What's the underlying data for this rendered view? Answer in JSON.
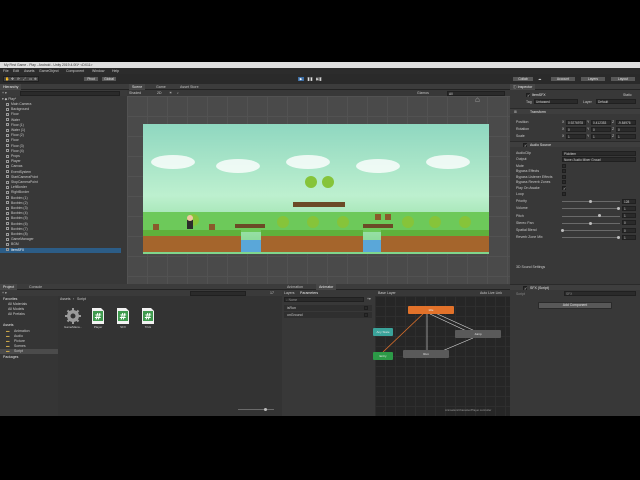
{
  "window": {
    "title": "My First Game - Play - Android - Unity 2019.4.0f1* <DX11>",
    "menu": [
      "File",
      "Edit",
      "Assets",
      "GameObject",
      "Component",
      "Window",
      "Help"
    ]
  },
  "toolbar": {
    "pivot_label": "Pivot",
    "global_label": "Global",
    "collab_label": "Collab",
    "account_label": "Account",
    "layers_label": "Layers",
    "layout_label": "Layout"
  },
  "hierarchy": {
    "tab_label": "Hierarchy",
    "scene_name": "Play*",
    "items": [
      "Main Camera",
      "Background",
      "Floor",
      "Water",
      "Floor (1)",
      "Water (1)",
      "Floor (2)",
      "Floor",
      "Floor (3)",
      "Floor (4)",
      "Props",
      "Player",
      "Canvas",
      "EventSystem",
      "StartCameraPoint",
      "StopCameraPoint",
      "LeftBorder",
      "RightBorder",
      "Boxbtm (1)",
      "Boxbtm (2)",
      "Boxbtm (3)",
      "Boxbtm (4)",
      "Boxbtm (5)",
      "Boxbtm (6)",
      "Boxbtm (7)",
      "Boxbtm (8)",
      "GameManager",
      "BGM",
      "ItemSFX"
    ],
    "selected_item": "ItemSFX"
  },
  "scene_view": {
    "tabs": [
      "Scene",
      "Game",
      "Asset Store"
    ],
    "shading_mode": "Shaded",
    "gizmos_label": "Gizmos",
    "search_all": "All"
  },
  "inspector": {
    "tab_label": "Inspector",
    "object_name": "ItemSFX",
    "static_label": "Static",
    "tag_label": "Tag",
    "tag_value": "Untagged",
    "layer_label": "Layer",
    "layer_value": "Default",
    "transform": {
      "title": "Transform",
      "position_label": "Position",
      "rotation_label": "Rotation",
      "scale_label": "Scale",
      "position": [
        "0.9276978",
        "0.412353",
        "-9.84976"
      ],
      "rotation": [
        "0",
        "0",
        "0"
      ],
      "scale": [
        "1",
        "1",
        "1"
      ]
    },
    "audio_source": {
      "title": "Audio Source",
      "fields": [
        {
          "label": "AudioClip",
          "value": "Pickitem"
        },
        {
          "label": "Output",
          "value": "None (Audio Mixer Group)"
        }
      ],
      "toggles": [
        {
          "label": "Mute",
          "on": false
        },
        {
          "label": "Bypass Effects",
          "on": false
        },
        {
          "label": "Bypass Listener Effects",
          "on": false
        },
        {
          "label": "Bypass Reverb Zones",
          "on": false
        },
        {
          "label": "Play On Awake",
          "on": true
        },
        {
          "label": "Loop",
          "on": false
        }
      ],
      "sliders": [
        {
          "label": "Priority",
          "value": "128",
          "level": 0.5
        },
        {
          "label": "Volume",
          "value": "1",
          "level": 1.0
        },
        {
          "label": "Pitch",
          "value": "1",
          "level": 0.66
        },
        {
          "label": "Stereo Pan",
          "value": "0",
          "level": 0.5
        },
        {
          "label": "Spatial Blend",
          "value": "0",
          "level": 0.0
        },
        {
          "label": "Reverb Zone Mix",
          "value": "1",
          "level": 1.0
        }
      ],
      "sound_settings_label": "3D Sound Settings"
    },
    "script_component": {
      "title": "SFX (Script)",
      "script_label": "Script",
      "script_value": "SFX"
    },
    "add_component_label": "Add Component"
  },
  "project": {
    "tabs": [
      "Project",
      "Console"
    ],
    "count_badge": "17",
    "favorites_label": "Favorites",
    "favorites": [
      "All Materials",
      "All Models",
      "All Prefabs"
    ],
    "assets_label": "Assets",
    "folders": [
      "Animation",
      "Audio",
      "Picture",
      "Scenes",
      "Script"
    ],
    "packages_label": "Packages",
    "breadcrumb": [
      "Assets",
      "Script"
    ],
    "files": [
      {
        "name": "GameMana...",
        "icon": "gear-icon"
      },
      {
        "name": "Player",
        "icon": "csharp-script-icon"
      },
      {
        "name": "SFX",
        "icon": "csharp-script-icon"
      },
      {
        "name": "Trick",
        "icon": "csharp-script-icon"
      }
    ]
  },
  "animator": {
    "tabs": [
      "Animation",
      "Animator"
    ],
    "subtabs": [
      "Layers",
      "Parameters"
    ],
    "search_placeholder": "Name",
    "parameters": [
      "isRun",
      "onGround"
    ],
    "layer_name": "Base Layer",
    "auto_live_link": "Auto Live Link",
    "states": [
      {
        "name": "Idle",
        "color": "#e2722a"
      },
      {
        "name": "Jump",
        "color": "#5a5a5a"
      },
      {
        "name": "Run",
        "color": "#5a5a5a"
      },
      {
        "name": "Any State",
        "color": "#3aa39a"
      },
      {
        "name": "Entry",
        "color": "#2c9a47"
      }
    ],
    "footer_path": "Animation/Character/Player.controller"
  },
  "colors": {
    "accent_blue": "#3d6ea5",
    "play_blue": "#4a90d9",
    "selected_row": "#2c5d87",
    "state_orange": "#e2722a",
    "entry_green": "#2c9a47",
    "any_state_teal": "#3aa39a"
  }
}
